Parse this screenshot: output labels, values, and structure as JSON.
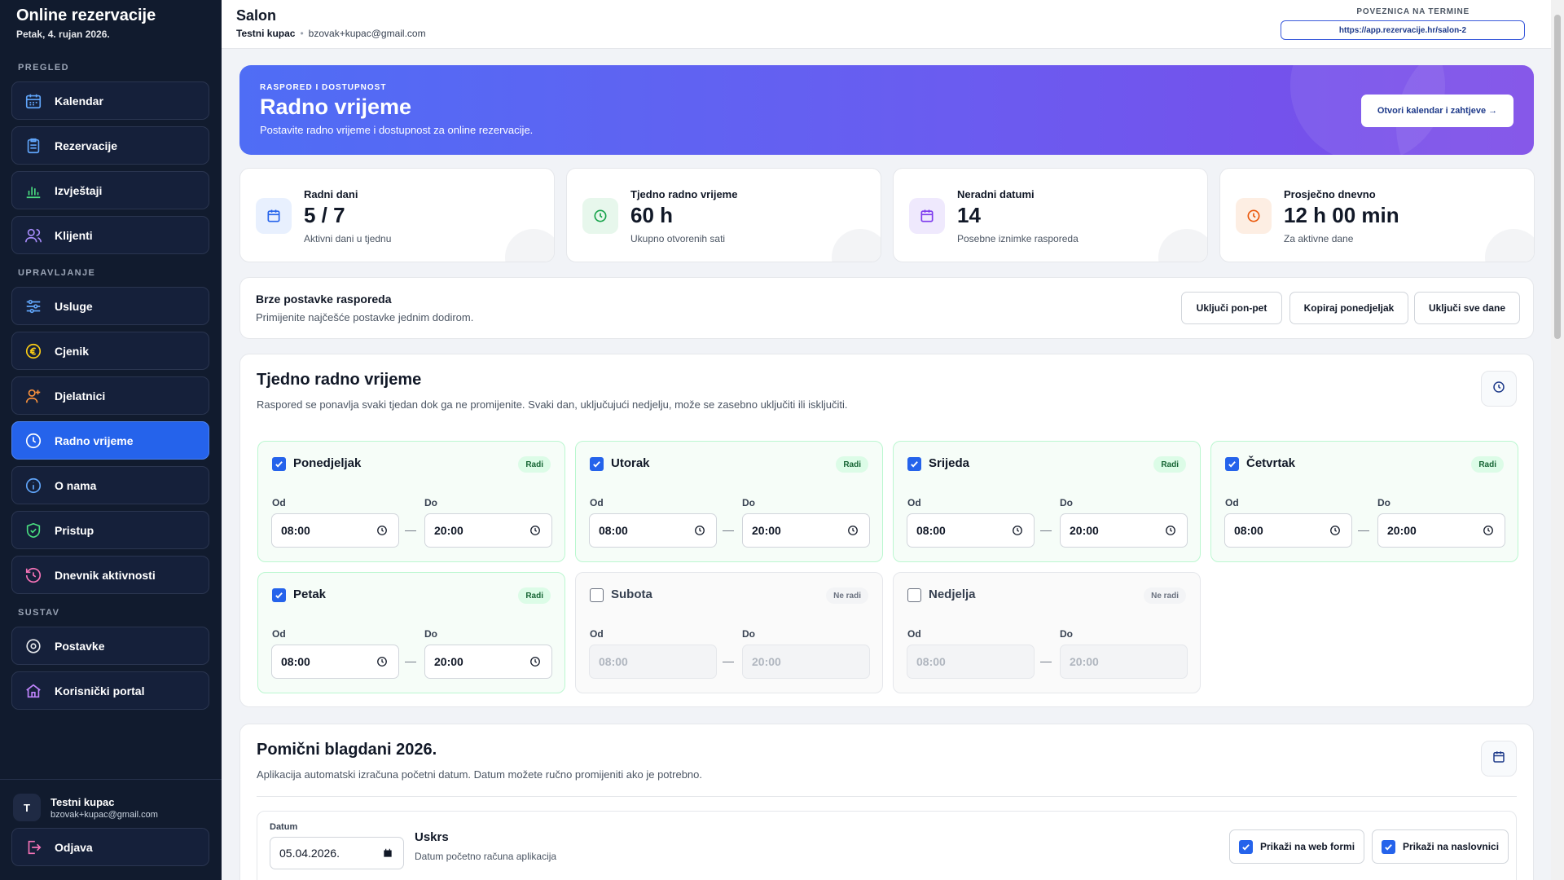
{
  "sidebar": {
    "title": "Online rezervacije",
    "date": "Petak, 4. rujan 2026.",
    "sections": {
      "overview": "PREGLED",
      "management": "UPRAVLJANJE",
      "system": "SUSTAV"
    },
    "items": {
      "kalendar": {
        "label": "Kalendar",
        "icon": "calendar-icon"
      },
      "rezervacije": {
        "label": "Rezervacije",
        "icon": "clipboard-icon"
      },
      "izvjestaji": {
        "label": "Izvještaji",
        "icon": "bar-chart-icon"
      },
      "klijenti": {
        "label": "Klijenti",
        "icon": "users-icon"
      },
      "usluge": {
        "label": "Usluge",
        "icon": "sliders-icon"
      },
      "cjenik": {
        "label": "Cjenik",
        "icon": "euro-icon"
      },
      "djelatnici": {
        "label": "Djelatnici",
        "icon": "user-plus-icon"
      },
      "radno_vrijeme": {
        "label": "Radno vrijeme",
        "icon": "clock-icon",
        "active": true
      },
      "o_nama": {
        "label": "O nama",
        "icon": "info-icon"
      },
      "pristup": {
        "label": "Pristup",
        "icon": "shield-check-icon"
      },
      "dnevnik": {
        "label": "Dnevnik aktivnosti",
        "icon": "history-icon"
      },
      "postavke": {
        "label": "Postavke",
        "icon": "gear-icon"
      },
      "portal": {
        "label": "Korisnički portal",
        "icon": "home-icon"
      }
    },
    "user": {
      "initial": "T",
      "name": "Testni kupac",
      "email": "bzovak+kupac@gmail.com"
    },
    "logout": {
      "label": "Odjava",
      "icon": "logout-icon"
    }
  },
  "topbar": {
    "title": "Salon",
    "user_name": "Testni kupac",
    "user_email": "bzovak+kupac@gmail.com",
    "link_label": "POVEZNICA NA TERMINE",
    "link_url": "https://app.rezervacije.hr/salon-2"
  },
  "hero": {
    "kicker": "RASPORED I DOSTUPNOST",
    "title": "Radno vrijeme",
    "subtitle": "Postavite radno vrijeme i dostupnost za online rezervacije.",
    "button": "Otvori kalendar i zahtjeve →"
  },
  "stats": [
    {
      "label": "Radni dani",
      "value": "5 / 7",
      "sub": "Aktivni dani u tjednu",
      "icon": "calendar-icon",
      "color": "#2563eb",
      "bg": "#e8f0fe"
    },
    {
      "label": "Tjedno radno vrijeme",
      "value": "60 h",
      "sub": "Ukupno otvorenih sati",
      "icon": "clock-icon",
      "color": "#16a34a",
      "bg": "#e7f7ec"
    },
    {
      "label": "Neradni datumi",
      "value": "14",
      "sub": "Posebne iznimke rasporeda",
      "icon": "calendar-icon",
      "color": "#7c3aed",
      "bg": "#efe9fd"
    },
    {
      "label": "Prosječno dnevno",
      "value": "12 h 00 min",
      "sub": "Za aktivne dane",
      "icon": "clock-icon",
      "color": "#ea580c",
      "bg": "#fdeee3"
    }
  ],
  "quick": {
    "title": "Brze postavke rasporeda",
    "subtitle": "Primijenite najčešće postavke jednim dodirom.",
    "buttons": [
      "Uključi pon-pet",
      "Kopiraj ponedjeljak",
      "Uključi sve dane"
    ]
  },
  "weekly": {
    "title": "Tjedno radno vrijeme",
    "subtitle": "Raspored se ponavlja svaki tjedan dok ga ne promijenite. Svaki dan, uključujući nedjelju, može se zasebno uključiti ili isključiti.",
    "from_label": "Od",
    "to_label": "Do",
    "days": [
      {
        "name": "Ponedjeljak",
        "enabled": true,
        "status": "Radi",
        "from": "08:00",
        "to": "20:00"
      },
      {
        "name": "Utorak",
        "enabled": true,
        "status": "Radi",
        "from": "08:00",
        "to": "20:00"
      },
      {
        "name": "Srijeda",
        "enabled": true,
        "status": "Radi",
        "from": "08:00",
        "to": "20:00"
      },
      {
        "name": "Četvrtak",
        "enabled": true,
        "status": "Radi",
        "from": "08:00",
        "to": "20:00"
      },
      {
        "name": "Petak",
        "enabled": true,
        "status": "Radi",
        "from": "08:00",
        "to": "20:00"
      },
      {
        "name": "Subota",
        "enabled": false,
        "status": "Ne radi",
        "from": "08:00",
        "to": "20:00"
      },
      {
        "name": "Nedjelja",
        "enabled": false,
        "status": "Ne radi",
        "from": "08:00",
        "to": "20:00"
      }
    ]
  },
  "holidays": {
    "title": "Pomični blagdani 2026.",
    "subtitle": "Aplikacija automatski izračuna početni datum. Datum možete ručno promijeniti ako je potrebno.",
    "date_label": "Datum",
    "date_value": "05.04.2026.",
    "holiday_name": "Uskrs",
    "holiday_note": "Datum početno računa aplikacija",
    "check_web": "Prikaži na web formi",
    "check_home": "Prikaži na naslovnici"
  }
}
